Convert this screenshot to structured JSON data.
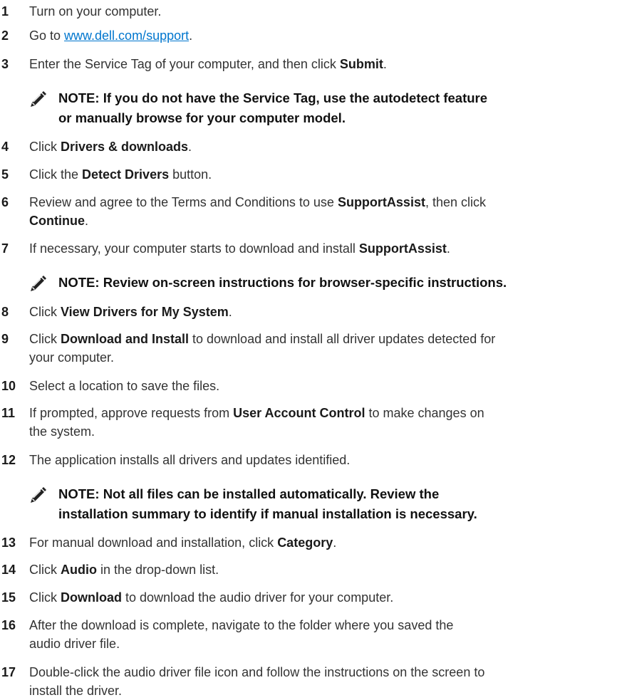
{
  "steps": [
    {
      "num": "1",
      "parts": [
        {
          "t": "Turn on your computer."
        }
      ]
    },
    {
      "num": "2",
      "parts": [
        {
          "t": "Go to "
        },
        {
          "t": "www.dell.com/support",
          "link": true
        },
        {
          "t": "."
        }
      ]
    },
    {
      "num": "3",
      "parts": [
        {
          "t": "Enter the Service Tag of your computer, and then click "
        },
        {
          "t": "Submit",
          "b": true
        },
        {
          "t": "."
        }
      ]
    },
    {
      "num": "4",
      "parts": [
        {
          "t": "Click "
        },
        {
          "t": "Drivers & downloads",
          "b": true
        },
        {
          "t": "."
        }
      ]
    },
    {
      "num": "5",
      "parts": [
        {
          "t": "Click the "
        },
        {
          "t": "Detect Drivers",
          "b": true
        },
        {
          "t": " button."
        }
      ]
    },
    {
      "num": "6",
      "parts": [
        {
          "t": "Review and agree to the Terms and Conditions to use "
        },
        {
          "t": "SupportAssist",
          "b": true
        },
        {
          "t": ", then click "
        },
        {
          "br": true
        },
        {
          "t": "Continue",
          "b": true
        },
        {
          "t": "."
        }
      ]
    },
    {
      "num": "7",
      "parts": [
        {
          "t": "If necessary, your computer starts to download and install "
        },
        {
          "t": "SupportAssist",
          "b": true
        },
        {
          "t": "."
        }
      ]
    },
    {
      "num": "8",
      "parts": [
        {
          "t": "Click "
        },
        {
          "t": "View Drivers for My System",
          "b": true
        },
        {
          "t": "."
        }
      ]
    },
    {
      "num": "9",
      "parts": [
        {
          "t": "Click "
        },
        {
          "t": "Download and Install",
          "b": true
        },
        {
          "t": " to download and install all driver updates detected for "
        },
        {
          "br": true
        },
        {
          "t": "your computer."
        }
      ]
    },
    {
      "num": "10",
      "parts": [
        {
          "t": "Select a location to save the files."
        }
      ]
    },
    {
      "num": "11",
      "parts": [
        {
          "t": "If prompted, approve requests from "
        },
        {
          "t": "User Account Control",
          "b": true
        },
        {
          "t": " to make changes on "
        },
        {
          "br": true
        },
        {
          "t": "the system."
        }
      ]
    },
    {
      "num": "12",
      "parts": [
        {
          "t": "The application installs all drivers and updates identified."
        }
      ]
    },
    {
      "num": "13",
      "parts": [
        {
          "t": "For manual download and installation, click "
        },
        {
          "t": "Category",
          "b": true
        },
        {
          "t": "."
        }
      ]
    },
    {
      "num": "14",
      "parts": [
        {
          "t": "Click "
        },
        {
          "t": "Audio",
          "b": true
        },
        {
          "t": " in the drop-down list."
        }
      ]
    },
    {
      "num": "15",
      "parts": [
        {
          "t": "Click "
        },
        {
          "t": "Download",
          "b": true
        },
        {
          "t": " to download the audio driver for your computer."
        }
      ]
    },
    {
      "num": "16",
      "parts": [
        {
          "t": "After the download is complete, navigate to the folder where you saved the "
        },
        {
          "br": true
        },
        {
          "t": "audio driver file."
        }
      ]
    },
    {
      "num": "17",
      "parts": [
        {
          "t": "Double-click the audio driver file icon and follow the instructions on the screen to "
        },
        {
          "br": true
        },
        {
          "t": "install the driver."
        }
      ]
    }
  ],
  "notes": [
    {
      "lines": [
        "NOTE: If you do not have the Service Tag, use the autodetect feature",
        "or manually browse for your computer model."
      ]
    },
    {
      "lines": [
        "NOTE: Review on-screen instructions for browser-specific instructions."
      ]
    },
    {
      "lines": [
        "NOTE: Not all files can be installed automatically. Review the",
        "installation summary to identify if manual installation is necessary."
      ]
    }
  ],
  "icons": {
    "note": "pencil-note-icon"
  },
  "colors": {
    "link": "#0076ce",
    "text": "#333333"
  }
}
